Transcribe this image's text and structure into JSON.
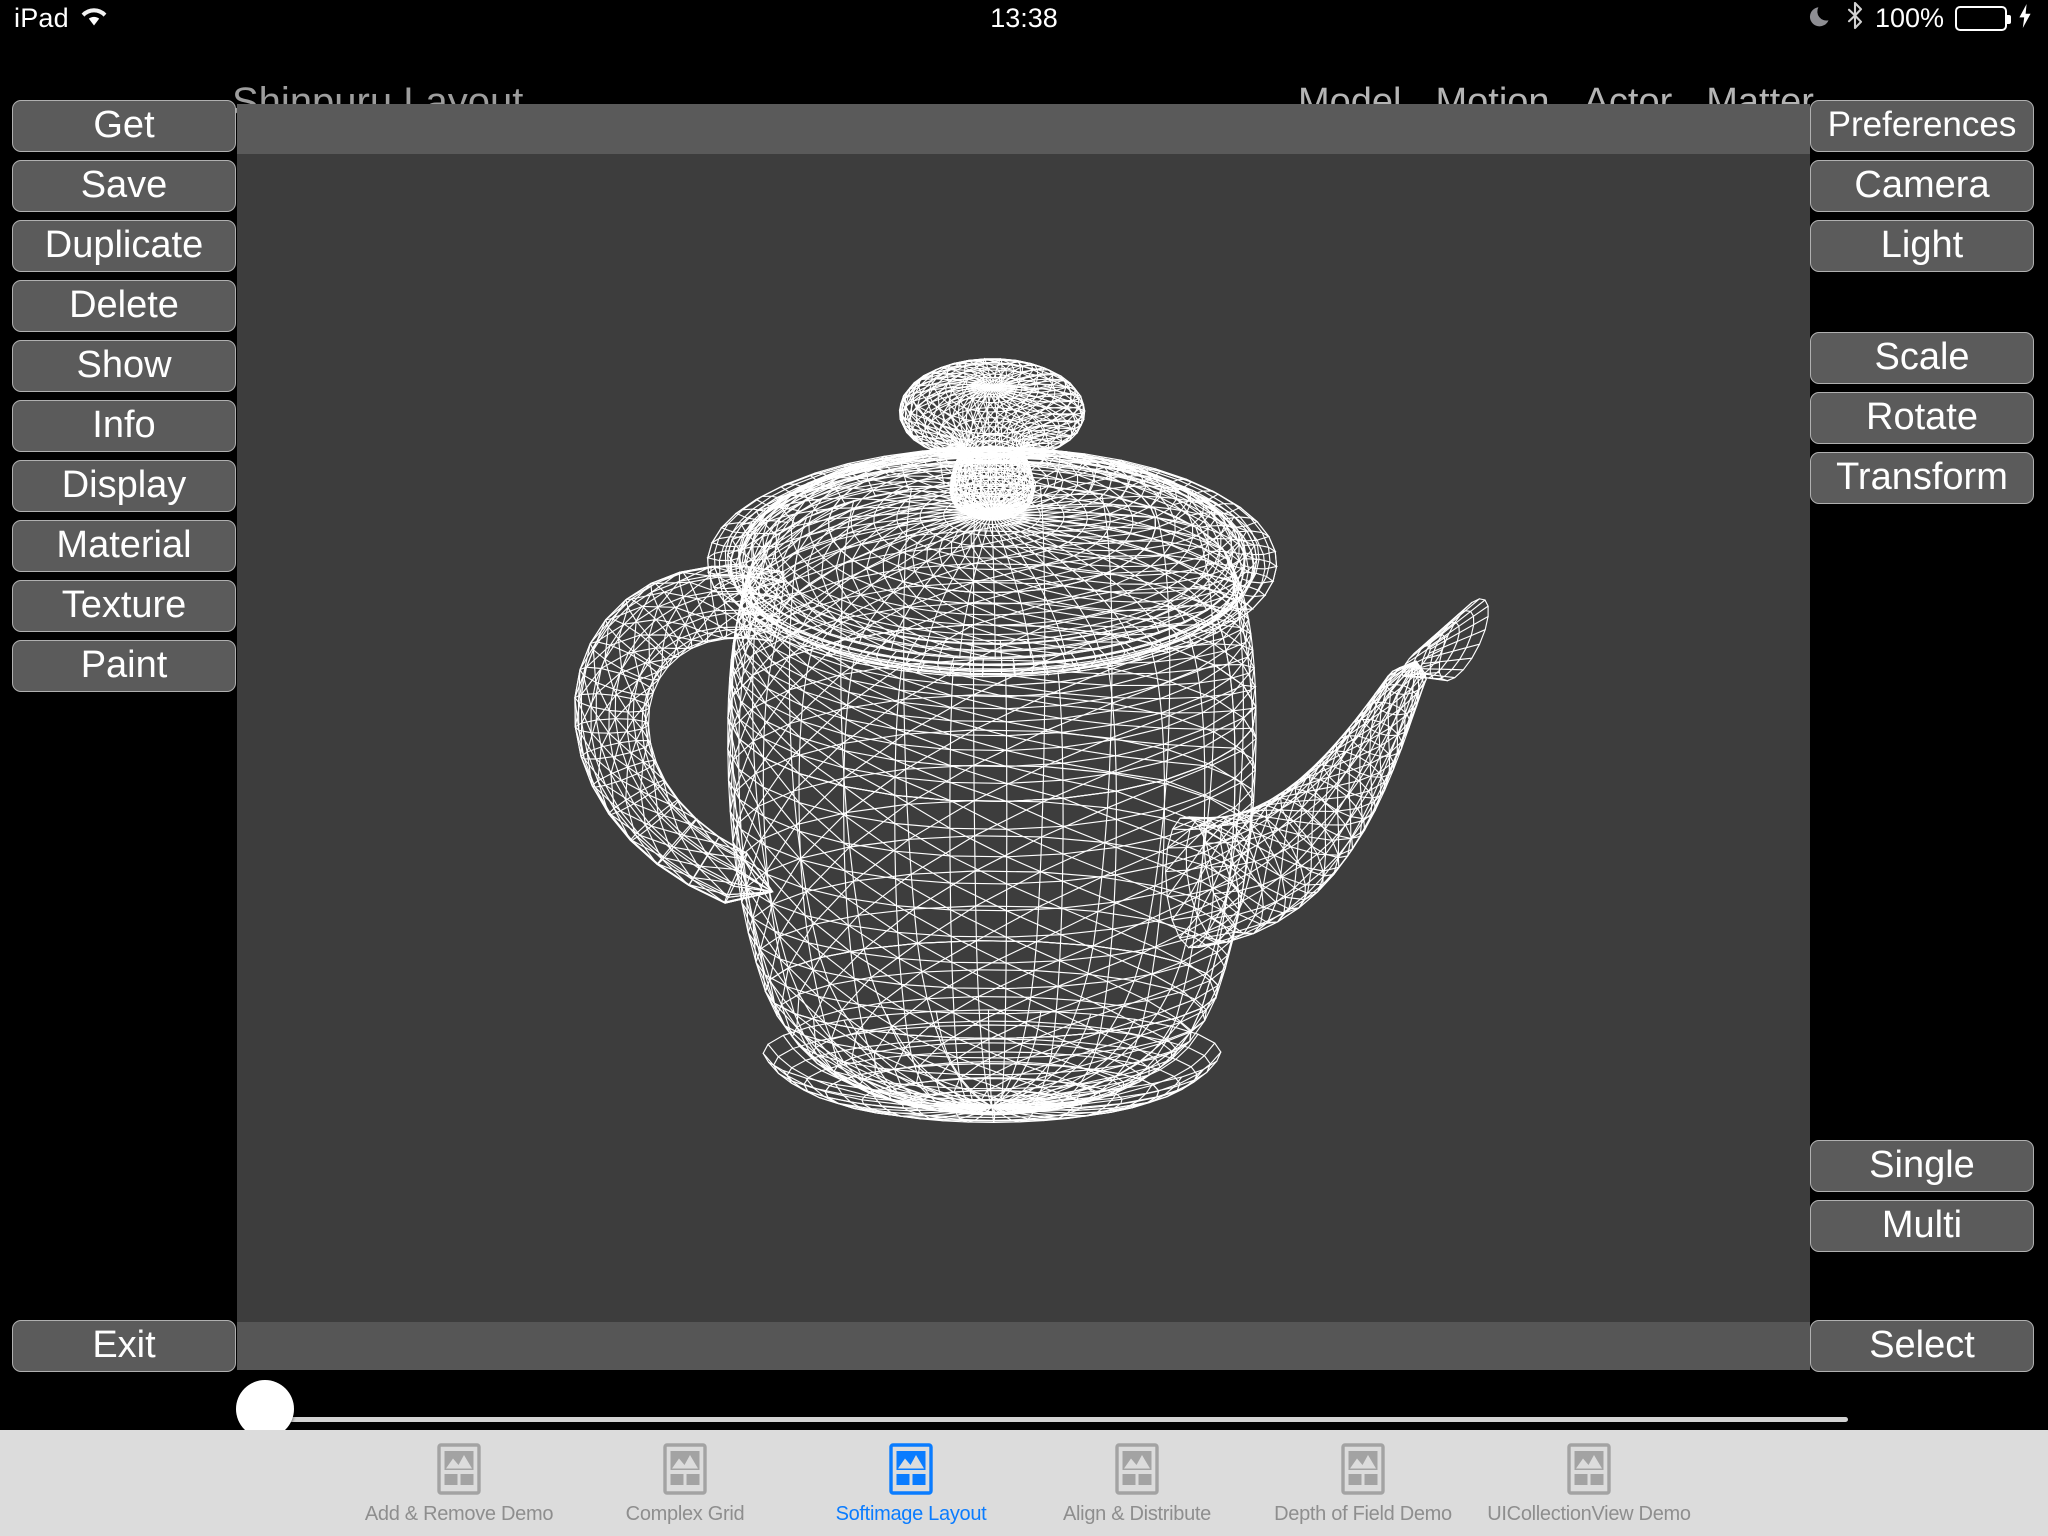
{
  "status_bar": {
    "carrier": "iPad",
    "wifi_icon": "wifi-icon",
    "time": "13:38",
    "dnd_icon": "moon-icon",
    "bluetooth_icon": "bluetooth-icon",
    "battery_percent": "100%",
    "battery_fill_color": "#4cd964",
    "charging_icon": "lightning-bolt-icon"
  },
  "nav": {
    "title": "Shinpuru Layout",
    "menu": [
      {
        "label": "Model"
      },
      {
        "label": "Motion"
      },
      {
        "label": "Actor"
      },
      {
        "label": "Matter"
      }
    ]
  },
  "left_rail": {
    "buttons": [
      {
        "label": "Get"
      },
      {
        "label": "Save"
      },
      {
        "label": "Duplicate"
      },
      {
        "label": "Delete"
      },
      {
        "label": "Show"
      },
      {
        "label": "Info"
      },
      {
        "label": "Display"
      },
      {
        "label": "Material"
      },
      {
        "label": "Texture"
      },
      {
        "label": "Paint"
      }
    ],
    "exit": {
      "label": "Exit"
    }
  },
  "right_rail": {
    "group_one": [
      {
        "label": "Preferences"
      },
      {
        "label": "Camera"
      },
      {
        "label": "Light"
      }
    ],
    "group_two": [
      {
        "label": "Scale"
      },
      {
        "label": "Rotate"
      },
      {
        "label": "Transform"
      }
    ],
    "group_three": [
      {
        "label": "Single"
      },
      {
        "label": "Multi"
      }
    ],
    "select": {
      "label": "Select"
    }
  },
  "viewport": {
    "model_name": "utah-teapot-wireframe",
    "wireframe_color": "#ffffff",
    "background_color": "#3d3d3d",
    "header_bar_color": "#5a5a5a",
    "footer_bar_color": "#565656"
  },
  "slider": {
    "name": "rotation-slider",
    "value": 0,
    "min": 0,
    "max": 100
  },
  "tab_bar": {
    "selected_color": "#0a7cff",
    "unselected_color": "#8e8e8e",
    "background_color": "#dcdcdc",
    "tabs": [
      {
        "label": "Add & Remove Demo",
        "icon": "gallery-icon",
        "selected": false
      },
      {
        "label": "Complex Grid",
        "icon": "gallery-icon",
        "selected": false
      },
      {
        "label": "Softimage Layout",
        "icon": "gallery-icon",
        "selected": true
      },
      {
        "label": "Align & Distribute",
        "icon": "gallery-icon",
        "selected": false
      },
      {
        "label": "Depth of Field Demo",
        "icon": "gallery-icon",
        "selected": false
      },
      {
        "label": "UICollectionView Demo",
        "icon": "gallery-icon",
        "selected": false
      }
    ]
  }
}
